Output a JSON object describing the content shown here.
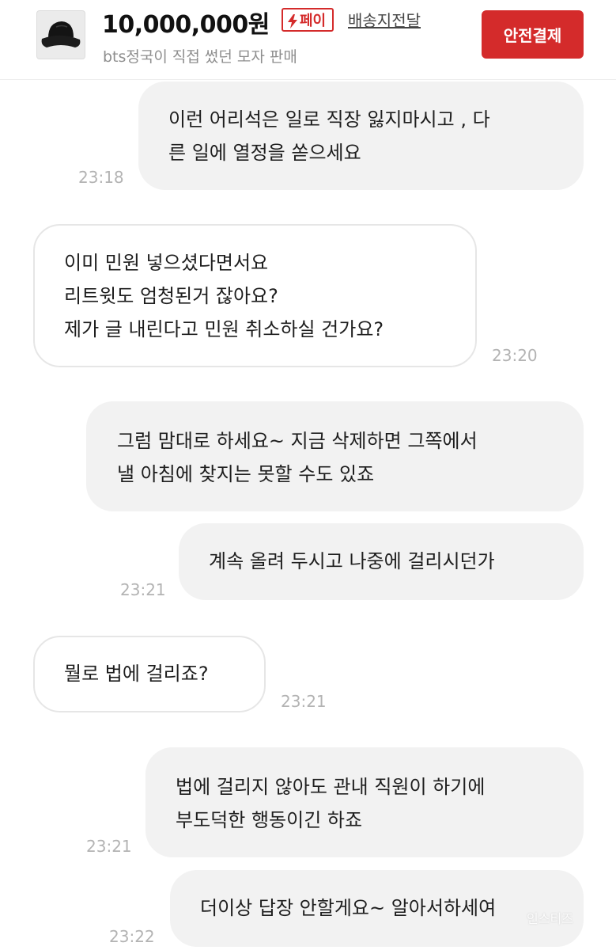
{
  "header": {
    "product_thumbnail": "black-bucket-hat-image",
    "price": "10,000,000원",
    "pay_badge": {
      "icon": "lightning-icon",
      "label": "페이"
    },
    "shipping": "배송지전달",
    "product_title": "bts정국이 직접 썼던 모자 판매",
    "safe_pay_button": "안전결제"
  },
  "colors": {
    "accent": "#d42b2b",
    "sent_bubble": "#f2f2f2",
    "received_bubble_border": "#e6e6e6",
    "timestamp": "#b3b3b3"
  },
  "messages": [
    {
      "side": "sent",
      "lines": [
        "이런 어리석은 일로 직장 잃지마시고 , 다",
        "른 일에 열정을 쏟으세요"
      ],
      "time": "23:18"
    },
    {
      "side": "received",
      "lines": [
        "이미 민원 넣으셨다면서요",
        "리트윗도 엄청된거 잖아요?",
        "제가 글 내린다고 민원 취소하실 건가요?"
      ],
      "time": "23:20"
    },
    {
      "side": "sent",
      "lines": [
        "그럼 맘대로 하세요~ 지금 삭제하면 그쪽에서",
        "낼 아침에 찾지는 못할 수도 있죠"
      ],
      "time": ""
    },
    {
      "side": "sent",
      "lines": [
        "계속 올려 두시고 나중에 걸리시던가"
      ],
      "time": "23:21"
    },
    {
      "side": "received",
      "lines": [
        "뭘로 법에 걸리죠?"
      ],
      "time": "23:21"
    },
    {
      "side": "sent",
      "lines": [
        "법에 걸리지 않아도 관내 직원이 하기에",
        "부도덕한 행동이긴 하죠"
      ],
      "time": "23:21"
    },
    {
      "side": "sent",
      "lines": [
        "더이상 답장 안할게요~ 알아서하세여"
      ],
      "time": "23:22"
    }
  ],
  "watermark": "인스티즈"
}
